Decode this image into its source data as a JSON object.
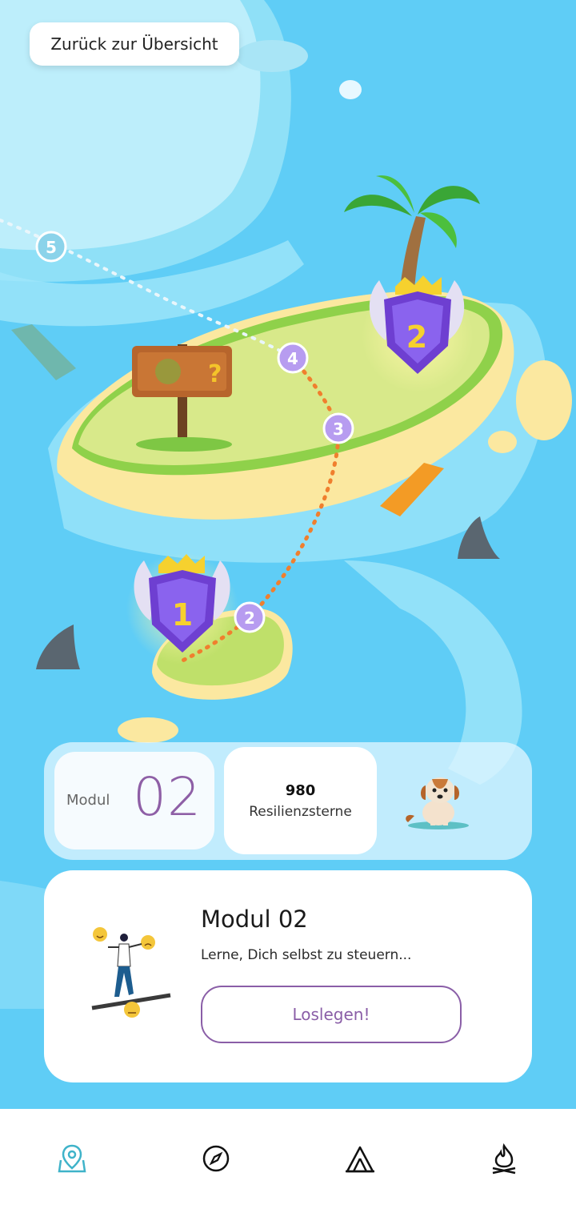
{
  "header": {
    "back_label": "Zurück zur Übersicht"
  },
  "map": {
    "waypoints": [
      "1",
      "2",
      "3",
      "4",
      "5"
    ],
    "badges": [
      {
        "number": "1",
        "name": "badge-1"
      },
      {
        "number": "2",
        "name": "badge-2"
      }
    ],
    "sign_glyph": "?"
  },
  "stats": {
    "module_label": "Modul",
    "module_number": "02",
    "stars_value": "980",
    "stars_label": "Resilienzsterne"
  },
  "module_card": {
    "title": "Modul 02",
    "description": "Lerne, Dich selbst zu steuern...",
    "start_label": "Loslegen!"
  },
  "bottom_nav": {
    "items": [
      {
        "icon": "map-pin-icon",
        "active": true
      },
      {
        "icon": "compass-icon",
        "active": false
      },
      {
        "icon": "tent-icon",
        "active": false
      },
      {
        "icon": "campfire-icon",
        "active": false
      }
    ]
  },
  "colors": {
    "ocean": "#5fcdf6",
    "accent_purple": "#8a5ea7",
    "nav_active": "#3fb3c9",
    "path_orange": "#f07f2e"
  }
}
